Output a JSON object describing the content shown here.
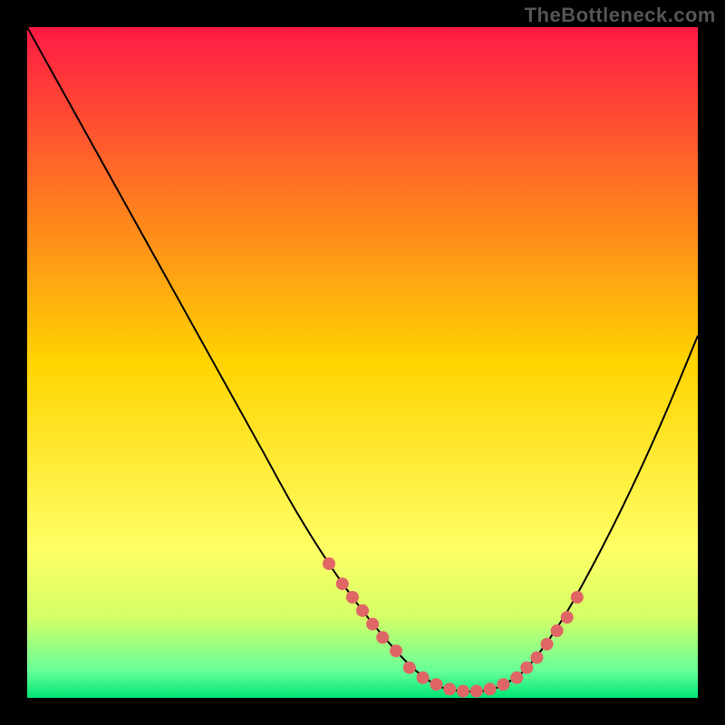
{
  "watermark": "TheBottleneck.com",
  "chart_data": {
    "type": "line",
    "title": "",
    "xlabel": "",
    "ylabel": "",
    "xlim": [
      0,
      100
    ],
    "ylim": [
      0,
      100
    ],
    "background_gradient": {
      "stops": [
        {
          "offset": 0.0,
          "color": "#ff1a44"
        },
        {
          "offset": 0.5,
          "color": "#ffd400"
        },
        {
          "offset": 0.78,
          "color": "#ffff66"
        },
        {
          "offset": 0.88,
          "color": "#d4ff66"
        },
        {
          "offset": 0.96,
          "color": "#66ff99"
        },
        {
          "offset": 1.0,
          "color": "#00e673"
        }
      ]
    },
    "series": [
      {
        "name": "curve",
        "color": "#000000",
        "x": [
          0,
          5,
          10,
          15,
          20,
          25,
          30,
          35,
          40,
          45,
          50,
          55,
          58,
          60,
          62,
          65,
          68,
          70,
          72,
          75,
          80,
          85,
          90,
          95,
          100
        ],
        "y": [
          100,
          91,
          82,
          73,
          64,
          55,
          46,
          37,
          28,
          20,
          13,
          7,
          4,
          2.5,
          1.5,
          1.0,
          1.0,
          1.5,
          2.5,
          5,
          12,
          21,
          31,
          42,
          54
        ]
      }
    ],
    "dots_left": {
      "color": "#e06666",
      "points": [
        {
          "x": 45,
          "y": 20
        },
        {
          "x": 47,
          "y": 17
        },
        {
          "x": 48.5,
          "y": 15
        },
        {
          "x": 50,
          "y": 13
        },
        {
          "x": 51.5,
          "y": 11
        },
        {
          "x": 53,
          "y": 9
        },
        {
          "x": 55,
          "y": 7
        }
      ]
    },
    "dots_bottom": {
      "color": "#e06666",
      "points": [
        {
          "x": 57,
          "y": 4.5
        },
        {
          "x": 59,
          "y": 3
        },
        {
          "x": 61,
          "y": 2
        },
        {
          "x": 63,
          "y": 1.3
        },
        {
          "x": 65,
          "y": 1.0
        },
        {
          "x": 67,
          "y": 1.0
        },
        {
          "x": 69,
          "y": 1.3
        },
        {
          "x": 71,
          "y": 2
        }
      ]
    },
    "dots_right": {
      "color": "#e06666",
      "points": [
        {
          "x": 73,
          "y": 3
        },
        {
          "x": 74.5,
          "y": 4.5
        },
        {
          "x": 76,
          "y": 6
        },
        {
          "x": 77.5,
          "y": 8
        },
        {
          "x": 79,
          "y": 10
        },
        {
          "x": 80.5,
          "y": 12
        },
        {
          "x": 82,
          "y": 15
        }
      ]
    }
  }
}
